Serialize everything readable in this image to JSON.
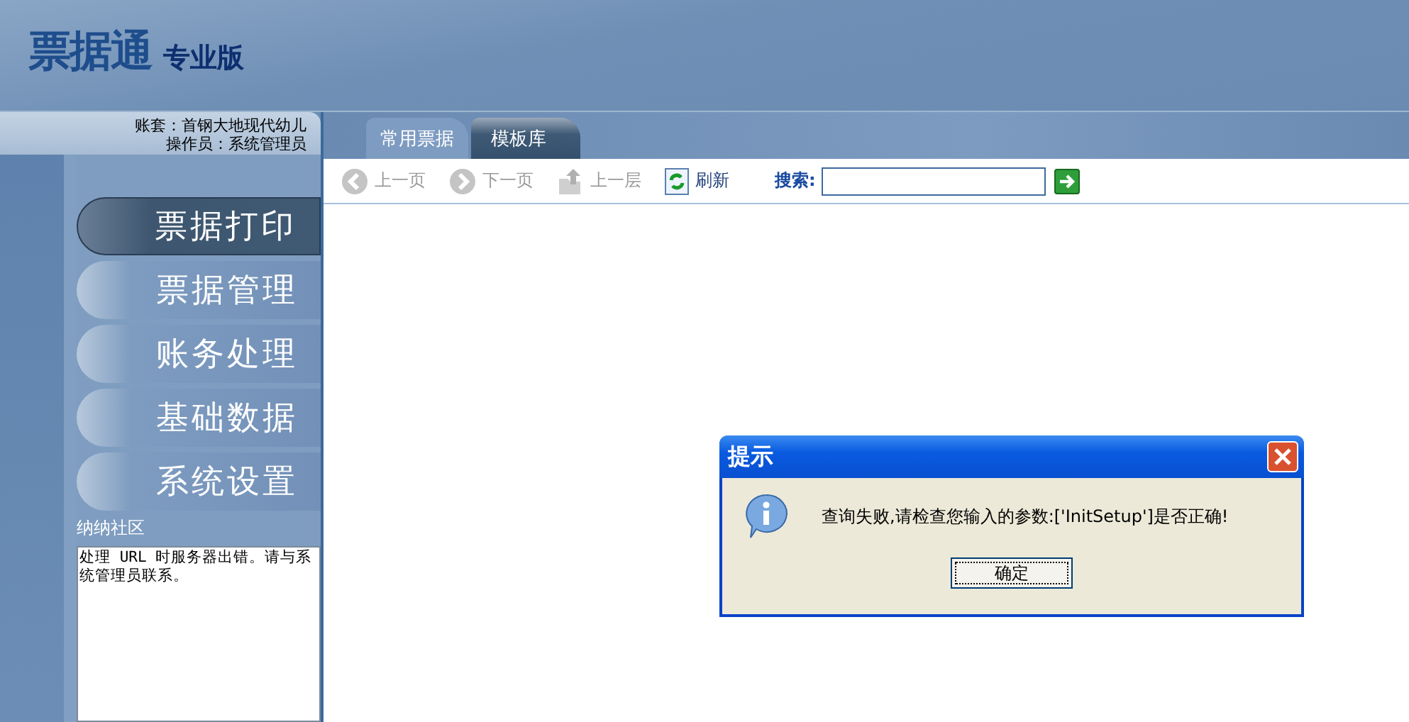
{
  "logo": {
    "title": "票据通",
    "edition": "专业版"
  },
  "account": {
    "book": "账套：首钢大地现代幼儿",
    "operator": "操作员：系统管理员"
  },
  "tabs": [
    {
      "label": "常用票据",
      "selected": false
    },
    {
      "label": "模板库",
      "selected": true
    }
  ],
  "toolbar": {
    "buttons": [
      {
        "label": "上一页",
        "disabled": true
      },
      {
        "label": "下一页",
        "disabled": true
      },
      {
        "label": "上一层",
        "disabled": true
      },
      {
        "label": "刷新",
        "disabled": false
      }
    ],
    "search_label": "搜索:"
  },
  "nav": [
    {
      "label": "票据打印",
      "selected": true
    },
    {
      "label": "票据管理",
      "selected": false
    },
    {
      "label": "账务处理",
      "selected": false
    },
    {
      "label": "基础数据",
      "selected": false
    },
    {
      "label": "系统设置",
      "selected": false
    }
  ],
  "community": {
    "title": "纳纳社区",
    "message": "处理 URL 时服务器出错。请与系统管理员联系。"
  },
  "dialog": {
    "title": "提示",
    "message": "查询失败,请检查您输入的参数:['InitSetup']是否正确!",
    "button": "确定"
  }
}
